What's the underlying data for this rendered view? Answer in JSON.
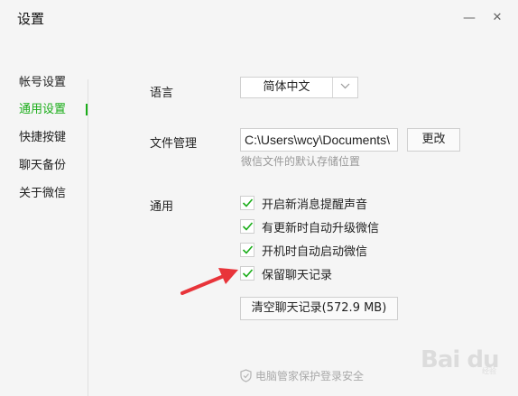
{
  "window": {
    "title": "设置",
    "minimize_glyph": "—",
    "close_glyph": "✕"
  },
  "sidebar": {
    "items": [
      {
        "label": "帐号设置",
        "active": false
      },
      {
        "label": "通用设置",
        "active": true
      },
      {
        "label": "快捷按键",
        "active": false
      },
      {
        "label": "聊天备份",
        "active": false
      },
      {
        "label": "关于微信",
        "active": false
      }
    ]
  },
  "general": {
    "language_label": "语言",
    "language_value": "简体中文",
    "file_label": "文件管理",
    "file_path": "C:\\Users\\wcy\\Documents\\",
    "change_button": "更改",
    "file_hint": "微信文件的默认存储位置",
    "general_label": "通用",
    "options": [
      {
        "label": "开启新消息提醒声音",
        "checked": true
      },
      {
        "label": "有更新时自动升级微信",
        "checked": true
      },
      {
        "label": "开机时自动启动微信",
        "checked": true
      },
      {
        "label": "保留聊天记录",
        "checked": true
      }
    ],
    "clear_button": "清空聊天记录(572.9 MB)"
  },
  "footer": {
    "text": "电脑管家保护登录安全"
  },
  "watermark": {
    "text": "Bai du",
    "sub": "经验"
  },
  "colors": {
    "accent": "#1aad19",
    "arrow": "#e8343a"
  }
}
